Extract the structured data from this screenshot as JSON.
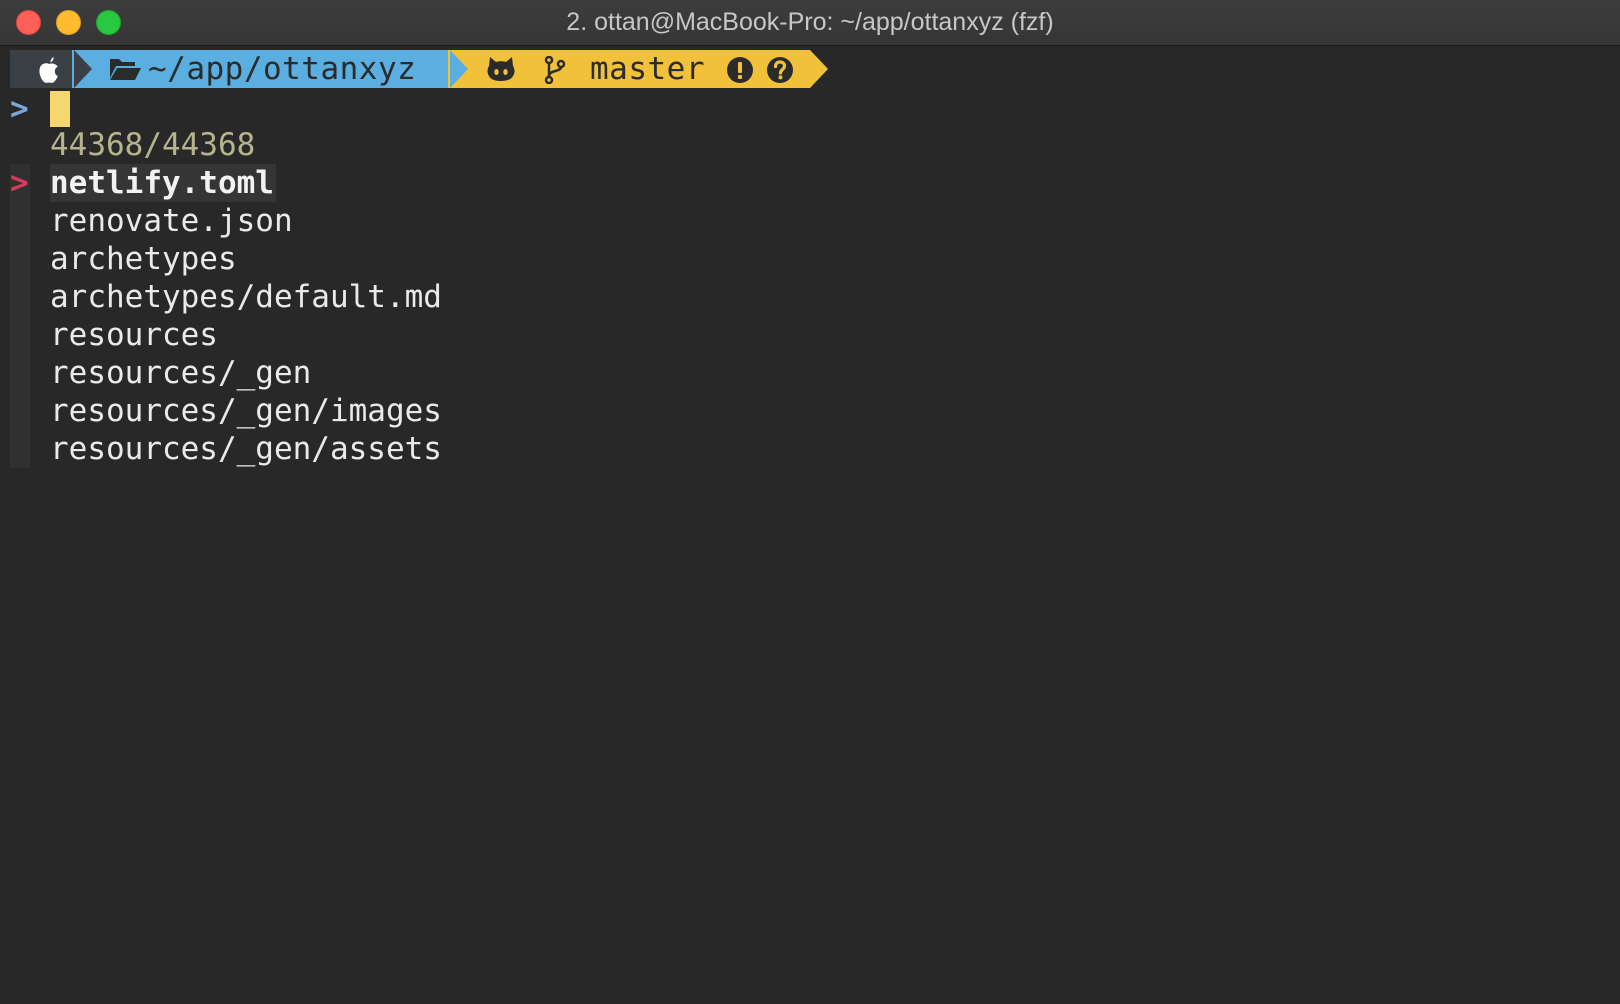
{
  "window": {
    "title": "2. ottan@MacBook-Pro: ~/app/ottanxyz (fzf)"
  },
  "prompt": {
    "directory": "~/app/ottanxyz",
    "branch": "master",
    "icons": [
      "apple-icon",
      "folder-open-icon",
      "github-octocat-icon",
      "git-branch-icon",
      "exclamation-circle-icon",
      "question-circle-icon"
    ],
    "colors": {
      "apple_segment": "#3b4045",
      "dir_segment": "#5aaee0",
      "git_segment": "#f2c13a"
    }
  },
  "fzf": {
    "prompt_symbol": ">",
    "query": "",
    "match_count": "44368/44368",
    "pointer_symbol": ">",
    "results": [
      "netlify.toml",
      "renovate.json",
      "archetypes",
      "archetypes/default.md",
      "resources",
      "resources/_gen",
      "resources/_gen/images",
      "resources/_gen/assets"
    ],
    "selected_index": 0
  }
}
